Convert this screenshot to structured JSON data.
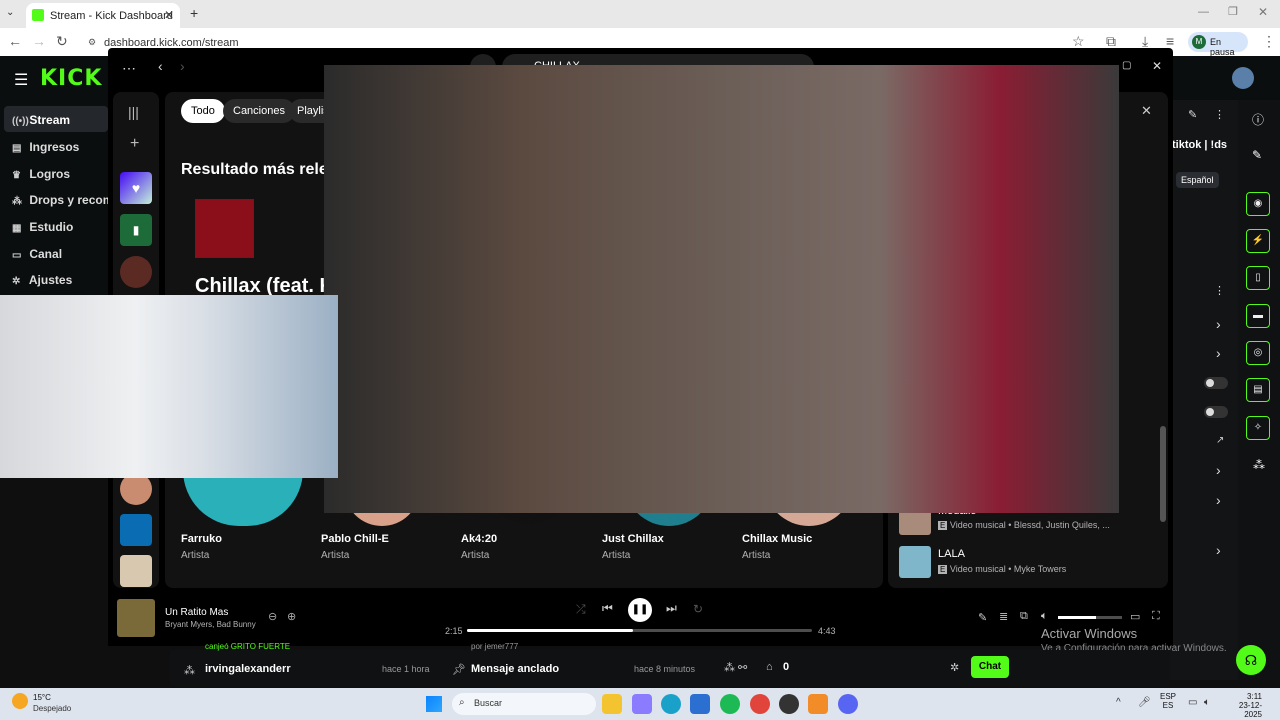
{
  "browser": {
    "tab_title": "Stream - Kick Dashboard",
    "url": "dashboard.kick.com/stream",
    "profile_initial": "M",
    "profile_status": "En pausa"
  },
  "kick": {
    "logo": "KICK",
    "nav": [
      "Stream",
      "Ingresos",
      "Logros",
      "Drops y recom",
      "Estudio",
      "Canal",
      "Ajustes"
    ],
    "lang": "Español",
    "tiktok": "tiktok | !ds",
    "chat_rows": [
      {
        "user": "irvingalexanderr",
        "time": "hace 1 hora",
        "above": "canjeó GRITO FUERTE"
      },
      {
        "label": "Mensaje anclado",
        "time": "hace 8 minutos",
        "by": "por jemer777"
      }
    ],
    "viewers": "0",
    "chat_button": "Chat"
  },
  "spotify": {
    "search_text": "CHILLAX",
    "filters": [
      "Todo",
      "Canciones",
      "Playlis"
    ],
    "top_result_heading": "Resultado más relev",
    "top_result_title": "Chillax (feat. K",
    "artists": [
      {
        "name": "Farruko",
        "type": "Artista"
      },
      {
        "name": "Pablo Chill-E",
        "type": "Artista"
      },
      {
        "name": "Ak4:20",
        "type": "Artista"
      },
      {
        "name": "Just Chillax",
        "type": "Artista"
      },
      {
        "name": "Chillax Music",
        "type": "Artista"
      }
    ],
    "right_items": [
      {
        "title": "Medallo",
        "sub": "Video musical • Blessd, Justin Quiles, ..."
      },
      {
        "title": "LALA",
        "sub": "Video musical • Myke Towers"
      }
    ],
    "now_playing": {
      "title": "Un Ratito Mas",
      "artist": "Bryant Myers, Bad Bunny"
    },
    "elapsed": "2:15",
    "duration": "4:43",
    "progress": 0.48,
    "volume": 0.6
  },
  "windows": {
    "activate_title": "Activar Windows",
    "activate_sub": "Ve a Configuración para activar Windows.",
    "weather_temp": "15°C",
    "weather_desc": "Despejado",
    "search": "Buscar",
    "lang1": "ESP",
    "lang2": "ES",
    "time": "3:11",
    "date": "23-12-2025"
  }
}
